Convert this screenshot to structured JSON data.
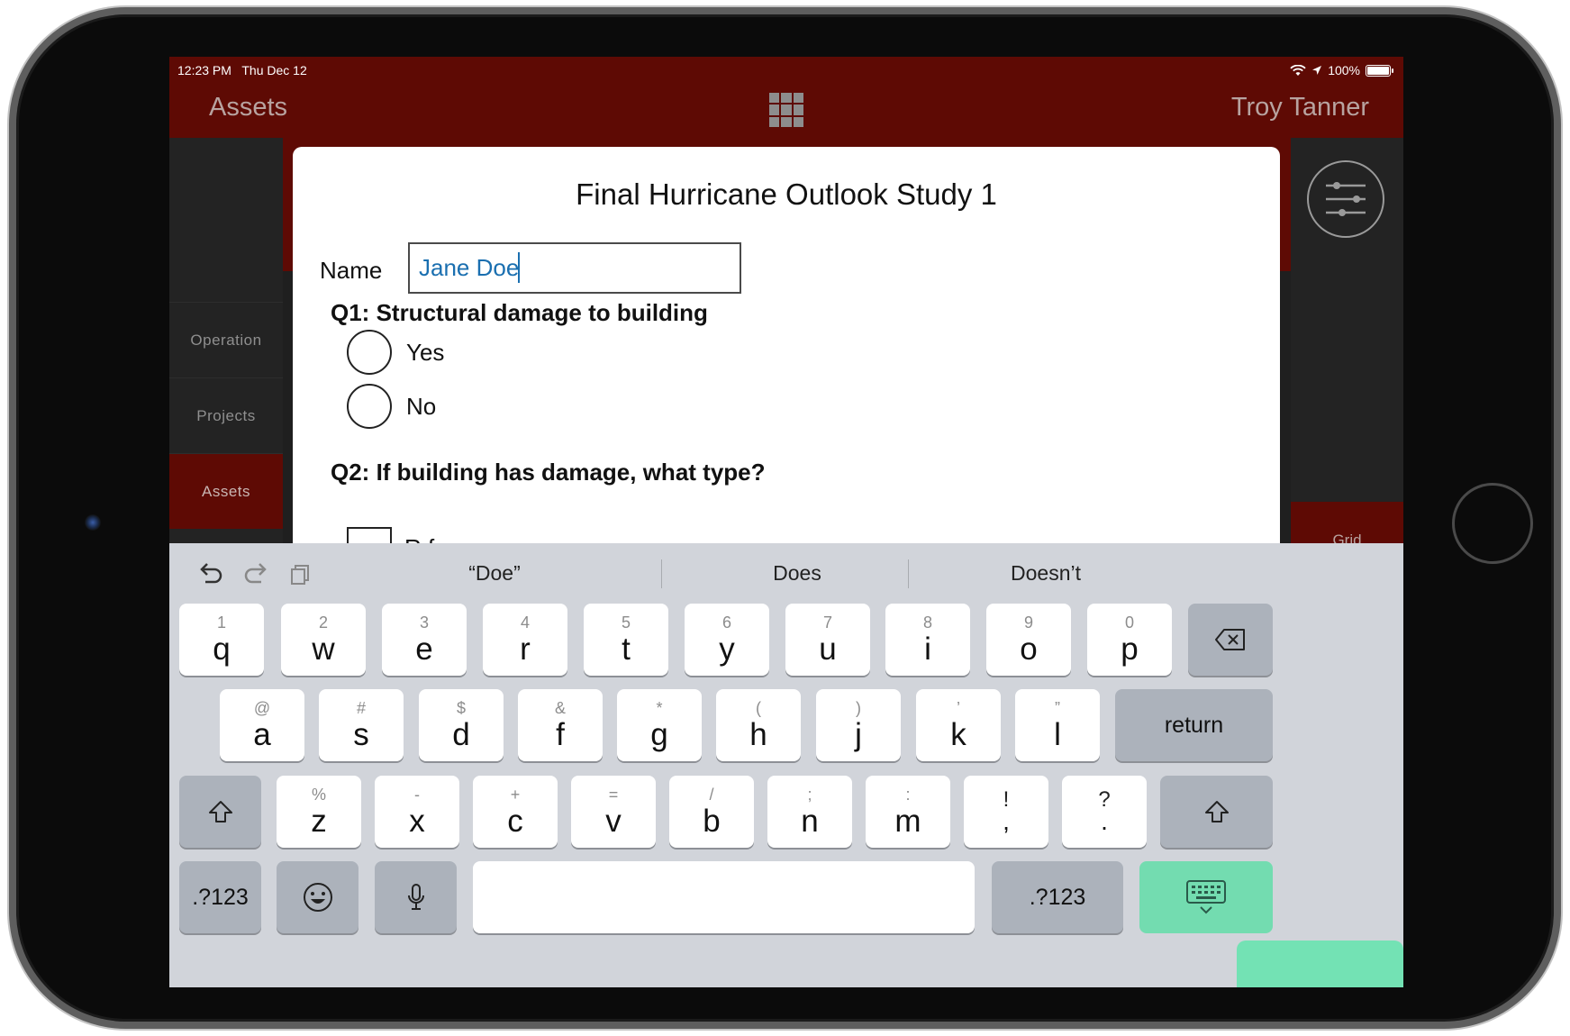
{
  "status": {
    "time": "12:23 PM",
    "date": "Thu Dec 12",
    "battery": "100%"
  },
  "header": {
    "left_title": "Assets",
    "right_user": "Troy Tanner"
  },
  "sidebar": {
    "items": [
      {
        "label": "Operation",
        "active": false
      },
      {
        "label": "Projects",
        "active": false
      },
      {
        "label": "Assets",
        "active": true
      }
    ]
  },
  "right_sidebar": {
    "grid_label": "Grid"
  },
  "survey": {
    "title": "Final Hurricane Outlook Study 1",
    "name_label": "Name",
    "name_value": "Jane Doe",
    "q1": {
      "title": "Q1: Structural damage to building",
      "options": [
        "Yes",
        "No"
      ]
    },
    "q2": {
      "title": "Q2: If building has damage, what type?",
      "first_option_partial": "R  f"
    }
  },
  "keyboard": {
    "suggestions": [
      "“Doe”",
      "Does",
      "Doesn’t"
    ],
    "row1": [
      {
        "hint": "1",
        "key": "q"
      },
      {
        "hint": "2",
        "key": "w"
      },
      {
        "hint": "3",
        "key": "e"
      },
      {
        "hint": "4",
        "key": "r"
      },
      {
        "hint": "5",
        "key": "t"
      },
      {
        "hint": "6",
        "key": "y"
      },
      {
        "hint": "7",
        "key": "u"
      },
      {
        "hint": "8",
        "key": "i"
      },
      {
        "hint": "9",
        "key": "o"
      },
      {
        "hint": "0",
        "key": "p"
      }
    ],
    "row2": [
      {
        "hint": "@",
        "key": "a"
      },
      {
        "hint": "#",
        "key": "s"
      },
      {
        "hint": "$",
        "key": "d"
      },
      {
        "hint": "&",
        "key": "f"
      },
      {
        "hint": "*",
        "key": "g"
      },
      {
        "hint": "(",
        "key": "h"
      },
      {
        "hint": ")",
        "key": "j"
      },
      {
        "hint": "’",
        "key": "k"
      },
      {
        "hint": "”",
        "key": "l"
      }
    ],
    "row3": [
      {
        "hint": "%",
        "key": "z"
      },
      {
        "hint": "-",
        "key": "x"
      },
      {
        "hint": "+",
        "key": "c"
      },
      {
        "hint": "=",
        "key": "v"
      },
      {
        "hint": "/",
        "key": "b"
      },
      {
        "hint": ";",
        "key": "n"
      },
      {
        "hint": ":",
        "key": "m"
      },
      {
        "hint": "!",
        "key": ","
      },
      {
        "hint": "?",
        "key": "."
      }
    ],
    "return_label": "return",
    "numbers_label": ".?123",
    "icons": {
      "undo": "undo-icon",
      "redo": "redo-icon",
      "paste": "paste-icon",
      "backspace": "backspace-icon",
      "shift": "shift-icon",
      "emoji": "emoji-icon",
      "mic": "microphone-icon",
      "dismiss": "keyboard-dismiss-icon"
    },
    "highlight_color": "#6ee3b2"
  },
  "colors": {
    "brand": "#5e0a04",
    "input_text": "#1a6fb0",
    "keyboard_bg": "#d1d4da"
  }
}
